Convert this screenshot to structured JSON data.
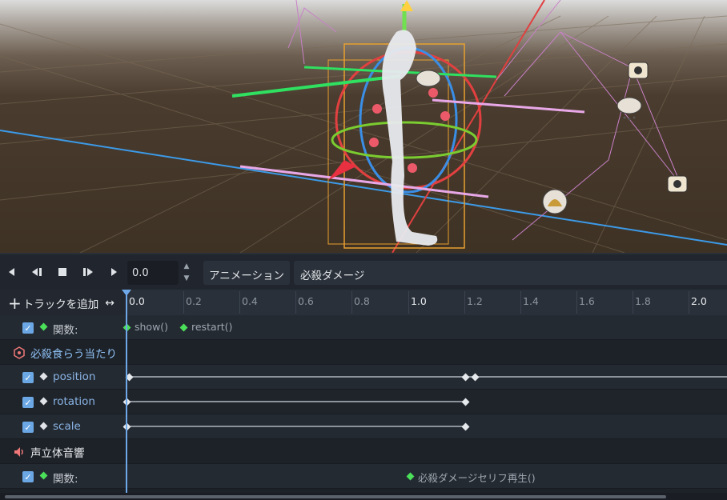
{
  "viewport": {
    "description_icons": [
      "bone-gizmo",
      "camera-icon",
      "weather-icon",
      "light-icon"
    ]
  },
  "toolbar": {
    "play_back_icon": "play-backward-icon",
    "time_value": "0.0",
    "anim_label": "アニメーション",
    "anim_selected": "必殺ダメージ"
  },
  "ruler": {
    "add_track": "トラックを追加",
    "ticks": [
      "0.0",
      "0.2",
      "0.4",
      "0.6",
      "0.8",
      "1.0",
      "1.2",
      "1.4",
      "1.6",
      "1.8",
      "2.0"
    ]
  },
  "tracks": {
    "row1": {
      "label": "関数:",
      "keys": [
        "show()",
        "restart()"
      ]
    },
    "group1": {
      "label": "必殺食らう当たり"
    },
    "row_position": {
      "label": "position"
    },
    "row_rotation": {
      "label": "rotation"
    },
    "row_scale": {
      "label": "scale"
    },
    "group2": {
      "label": "声立体音響"
    },
    "row_fn2": {
      "label": "関数:",
      "key": "必殺ダメージセリフ再生()"
    }
  },
  "colors": {
    "accent": "#6fa8e8",
    "key_green": "#4be05a"
  }
}
